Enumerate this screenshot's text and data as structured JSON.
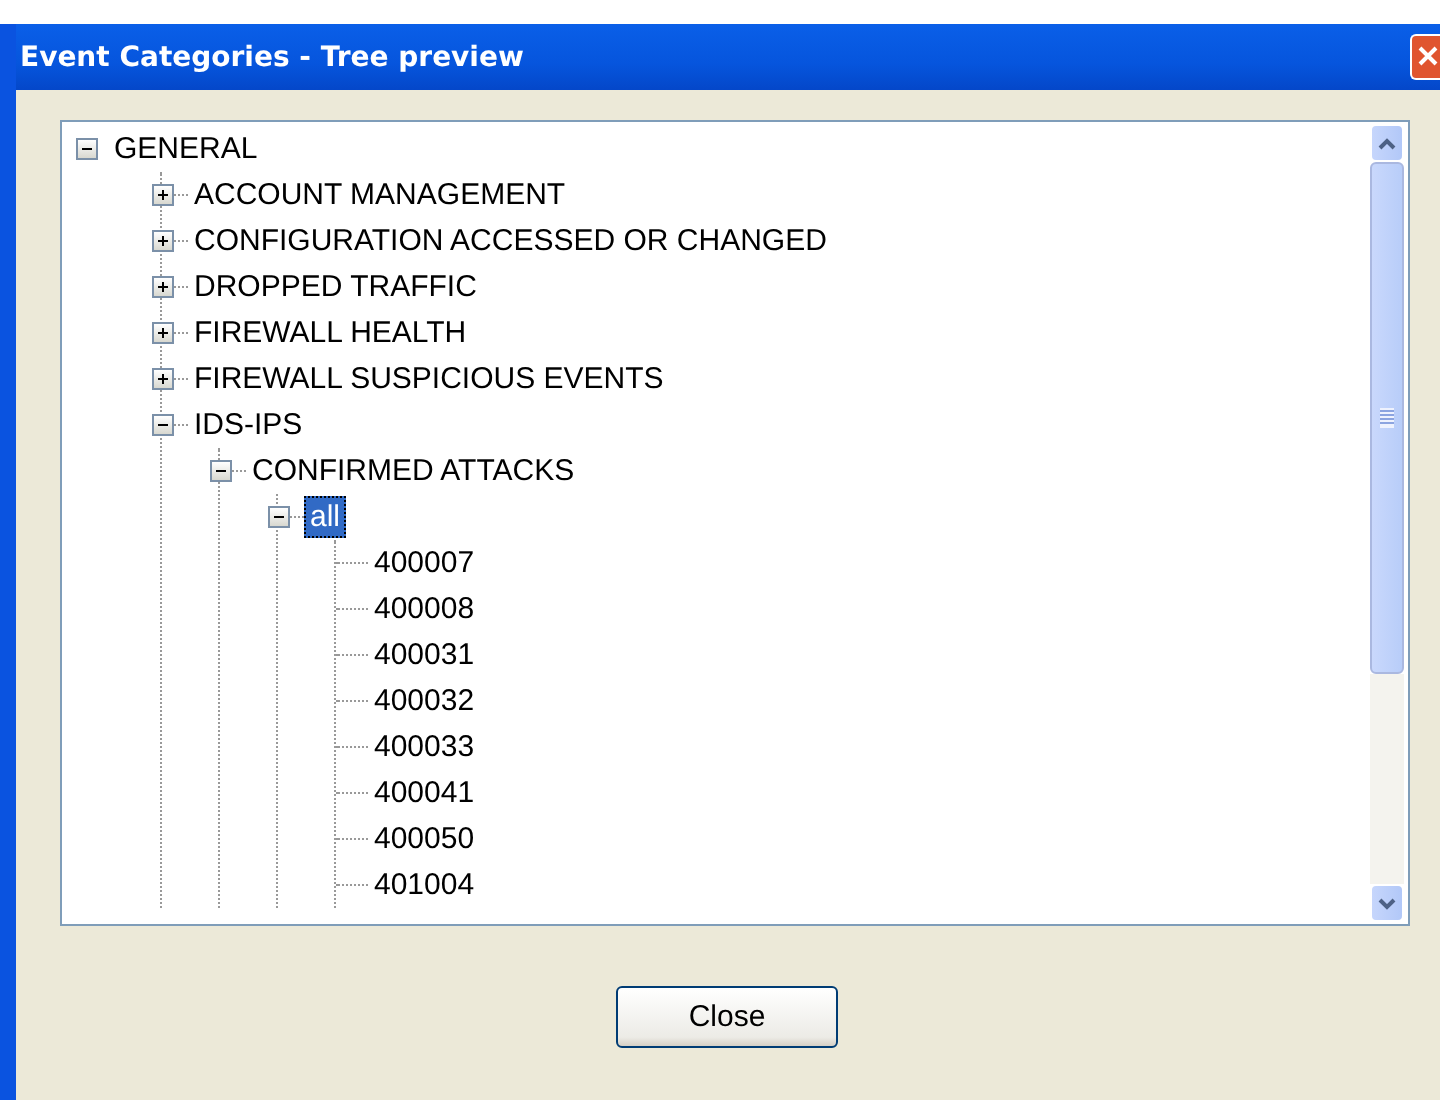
{
  "window": {
    "title": "Event Categories - Tree preview"
  },
  "tree": [
    {
      "label": "GENERAL",
      "kind": "node",
      "expanded": true,
      "selected": false,
      "children": [
        {
          "label": "ACCOUNT MANAGEMENT",
          "kind": "node",
          "expanded": false,
          "selected": false
        },
        {
          "label": "CONFIGURATION ACCESSED OR CHANGED",
          "kind": "node",
          "expanded": false,
          "selected": false
        },
        {
          "label": "DROPPED TRAFFIC",
          "kind": "node",
          "expanded": false,
          "selected": false
        },
        {
          "label": "FIREWALL HEALTH",
          "kind": "node",
          "expanded": false,
          "selected": false
        },
        {
          "label": "FIREWALL SUSPICIOUS EVENTS",
          "kind": "node",
          "expanded": false,
          "selected": false
        },
        {
          "label": "IDS-IPS",
          "kind": "node",
          "expanded": true,
          "selected": false,
          "children": [
            {
              "label": "CONFIRMED ATTACKS",
              "kind": "node",
              "expanded": true,
              "selected": false,
              "children": [
                {
                  "label": "all",
                  "kind": "node",
                  "expanded": true,
                  "selected": true,
                  "children": [
                    {
                      "label": "400007",
                      "kind": "leaf",
                      "selected": false
                    },
                    {
                      "label": "400008",
                      "kind": "leaf",
                      "selected": false
                    },
                    {
                      "label": "400031",
                      "kind": "leaf",
                      "selected": false
                    },
                    {
                      "label": "400032",
                      "kind": "leaf",
                      "selected": false
                    },
                    {
                      "label": "400033",
                      "kind": "leaf",
                      "selected": false
                    },
                    {
                      "label": "400041",
                      "kind": "leaf",
                      "selected": false
                    },
                    {
                      "label": "400050",
                      "kind": "leaf",
                      "selected": false
                    },
                    {
                      "label": "401004",
                      "kind": "leaf",
                      "selected": false
                    }
                  ]
                }
              ]
            }
          ]
        }
      ]
    }
  ],
  "buttons": [
    {
      "label": "Close"
    }
  ]
}
